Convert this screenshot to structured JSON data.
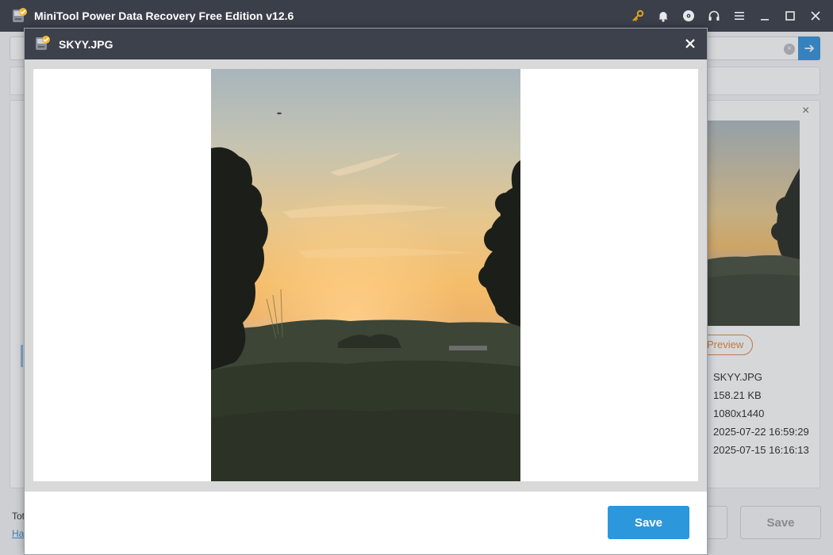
{
  "app": {
    "title": "MiniTool Power Data Recovery Free Edition v12.6",
    "titlebar_icons": [
      "key-icon",
      "bell-icon",
      "disc-icon",
      "headset-icon",
      "menu-icon",
      "minimize-icon",
      "maximize-icon",
      "close-icon"
    ]
  },
  "background": {
    "search_clear": "×",
    "preview_close": "×",
    "preview_button": "Preview",
    "file_info": {
      "name": "SKYY.JPG",
      "size": "158.21 KB",
      "dimensions": "1080x1440",
      "date_created": "2025-07-22 16:59:29",
      "date_modified": "2025-07-15 16:16:13"
    },
    "footer_text": "Tot",
    "footer_link": "Ha",
    "save_label": "Save"
  },
  "dialog": {
    "title": "SKYY.JPG",
    "save_label": "Save"
  },
  "colors": {
    "titlebar": "#3b3f4a",
    "accent_blue": "#2d97dc",
    "accent_orange": "#e0823a",
    "key_icon": "#e3a21a"
  }
}
